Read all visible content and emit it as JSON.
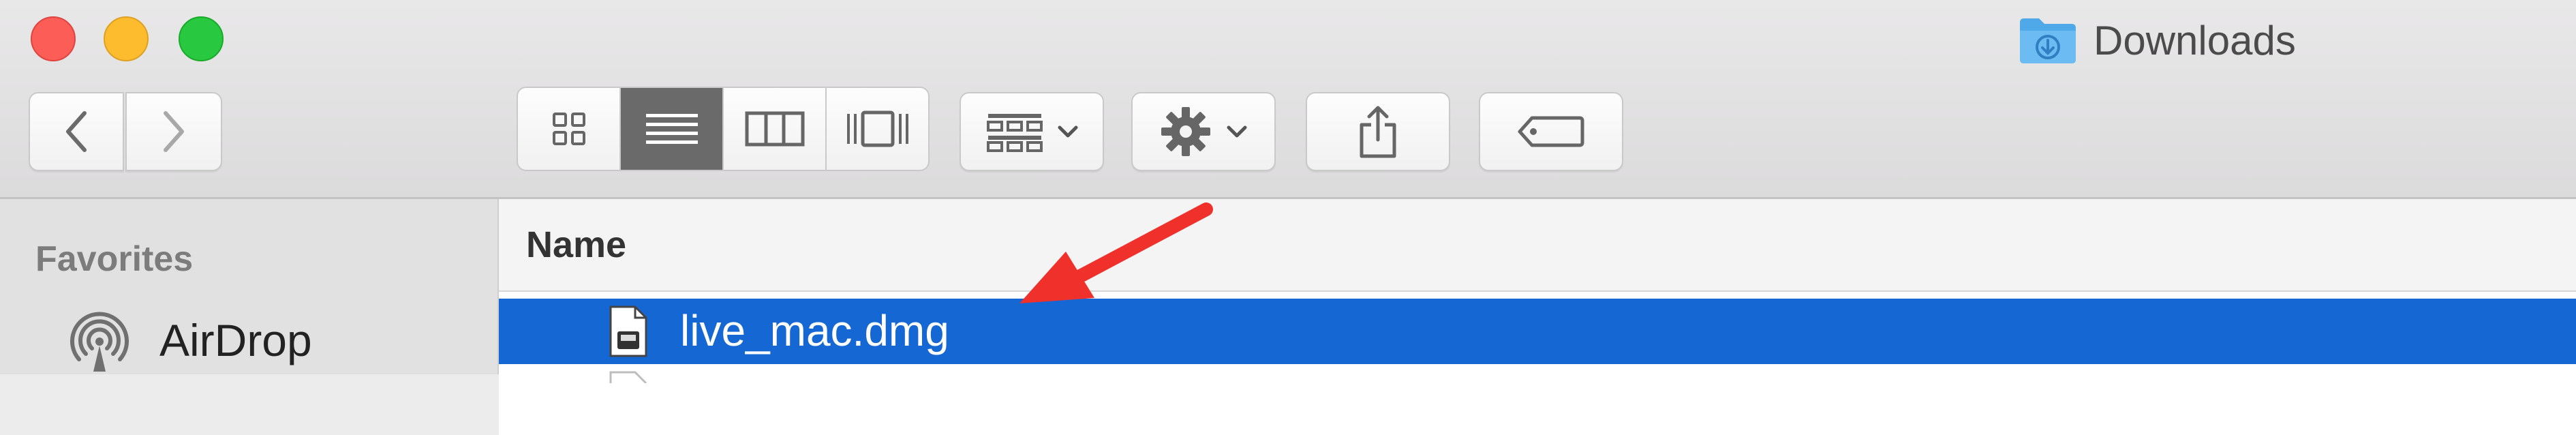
{
  "window": {
    "title": "Downloads"
  },
  "colors": {
    "selection": "#1568d4",
    "annotation_arrow": "#f0302a",
    "close": "#fc5d57",
    "minimize": "#fdbc2e",
    "zoom": "#28c840"
  },
  "toolbar": {
    "nav": [
      "chevron-left-icon",
      "chevron-right-icon"
    ],
    "view_modes": [
      {
        "icon": "icon-view-icon",
        "active": false
      },
      {
        "icon": "list-view-icon",
        "active": true
      },
      {
        "icon": "column-view-icon",
        "active": false
      },
      {
        "icon": "cover-flow-icon",
        "active": false
      }
    ],
    "buttons": [
      "group-by-icon",
      "action-gear-icon",
      "share-icon",
      "tag-icon"
    ]
  },
  "sidebar": {
    "section": "Favorites",
    "items": [
      {
        "label": "AirDrop",
        "icon": "airdrop-icon"
      }
    ]
  },
  "content": {
    "columns": [
      "Name"
    ],
    "files": [
      {
        "name": "live_mac.dmg",
        "icon": "dmg-file-icon",
        "selected": true
      }
    ]
  }
}
